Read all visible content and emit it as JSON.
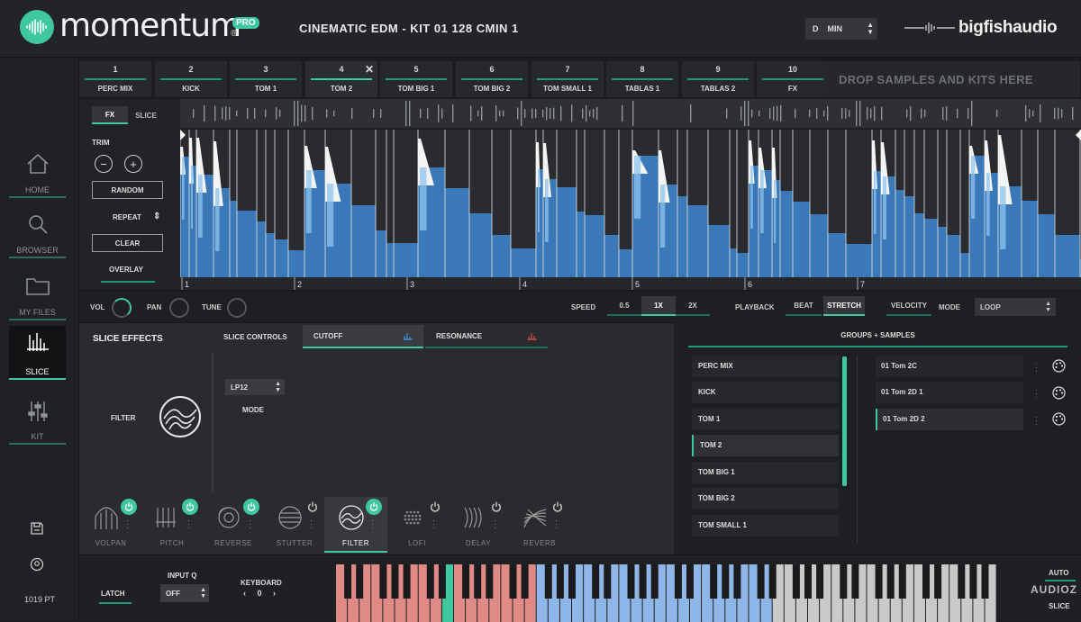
{
  "header": {
    "logo_text": "momentum",
    "logo_badge": "PRO",
    "logo_reg": "®",
    "kit_title": "CINEMATIC EDM - KIT 01 128 CMIN 1",
    "key": {
      "root": "D",
      "scale": "MIN"
    },
    "brand": "bigfishaudio"
  },
  "sidebar": {
    "items": [
      {
        "label": "HOME",
        "icon": "home-icon"
      },
      {
        "label": "BROWSER",
        "icon": "search-icon"
      },
      {
        "label": "MY FILES",
        "icon": "folder-icon"
      },
      {
        "label": "SLICE",
        "icon": "slice-icon",
        "active": true
      },
      {
        "label": "KIT",
        "icon": "kit-sliders-icon"
      }
    ],
    "points": "1019 PT"
  },
  "tabs": [
    {
      "num": "1",
      "name": "PERC MIX"
    },
    {
      "num": "2",
      "name": "KICK"
    },
    {
      "num": "3",
      "name": "TOM 1"
    },
    {
      "num": "4",
      "name": "TOM 2",
      "active": true,
      "close": "✕"
    },
    {
      "num": "5",
      "name": "TOM BIG 1"
    },
    {
      "num": "6",
      "name": "TOM BIG 2"
    },
    {
      "num": "7",
      "name": "TOM SMALL 1"
    },
    {
      "num": "8",
      "name": "TABLAS 1"
    },
    {
      "num": "9",
      "name": "TABLAS 2"
    },
    {
      "num": "10",
      "name": "FX"
    }
  ],
  "dropzone": "DROP SAMPLES AND KITS HERE",
  "fx_panel": {
    "tabs": [
      "FX",
      "SLICE"
    ],
    "trim": "TRIM",
    "minus": "−",
    "plus": "+",
    "random": "RANDOM",
    "repeat": "REPEAT",
    "repeat_arrows": "⇕",
    "clear": "CLEAR",
    "overlay": "OVERLAY"
  },
  "waveform": {
    "bar_numbers": [
      "1",
      "2",
      "3",
      "4",
      "5",
      "6",
      "7"
    ],
    "fill_color": "#3a78b8",
    "highlight_color": "#8fc6ee"
  },
  "controls": {
    "vol": "VOL",
    "pan": "PAN",
    "tune": "TUNE",
    "speed": "SPEED",
    "speed_options": [
      "0.5",
      "1X",
      "2X"
    ],
    "speed_selected": "1X",
    "playback": "PLAYBACK",
    "playback_options": [
      "BEAT",
      "STRETCH"
    ],
    "playback_selected": "STRETCH",
    "velocity": "VELOCITY",
    "mode": "MODE",
    "mode_value": "LOOP"
  },
  "slice_effects": {
    "title": "SLICE EFFECTS",
    "tabs": [
      "SLICE CONTROLS",
      "CUTOFF",
      "RESONANCE"
    ],
    "active_tab": "CUTOFF",
    "filter_label": "FILTER",
    "filter_type": "LP12",
    "mode_label": "MODE",
    "effects": [
      {
        "name": "VOLPAN",
        "on": true
      },
      {
        "name": "PITCH",
        "on": true
      },
      {
        "name": "REVERSE",
        "on": true
      },
      {
        "name": "STUTTER",
        "on": false
      },
      {
        "name": "FILTER",
        "on": true,
        "active": true
      },
      {
        "name": "LOFI",
        "on": false
      },
      {
        "name": "DELAY",
        "on": false
      },
      {
        "name": "REVERB",
        "on": false
      }
    ]
  },
  "groups": {
    "title": "GROUPS + SAMPLES",
    "groups": [
      "PERC MIX",
      "KICK",
      "TOM 1",
      "TOM 2",
      "TOM BIG 1",
      "TOM BIG 2",
      "TOM SMALL 1"
    ],
    "selected_group": "TOM 2",
    "samples": [
      "01 Tom 2C",
      "01 Tom 2D 1",
      "01 Tom 2D 2"
    ],
    "selected_sample": "01 Tom 2D 2"
  },
  "bottom": {
    "latch": "LATCH",
    "input_q": "INPUT Q",
    "input_q_value": "OFF",
    "keyboard": "KEYBOARD",
    "octave": "‹ 0 ›",
    "auto": "AUTO",
    "slice": "SLICE",
    "watermark": "AUDIOZ"
  },
  "colors": {
    "accent": "#3fc8a0",
    "red_keys": "#e08a86",
    "blue_keys": "#8fb6e8"
  }
}
